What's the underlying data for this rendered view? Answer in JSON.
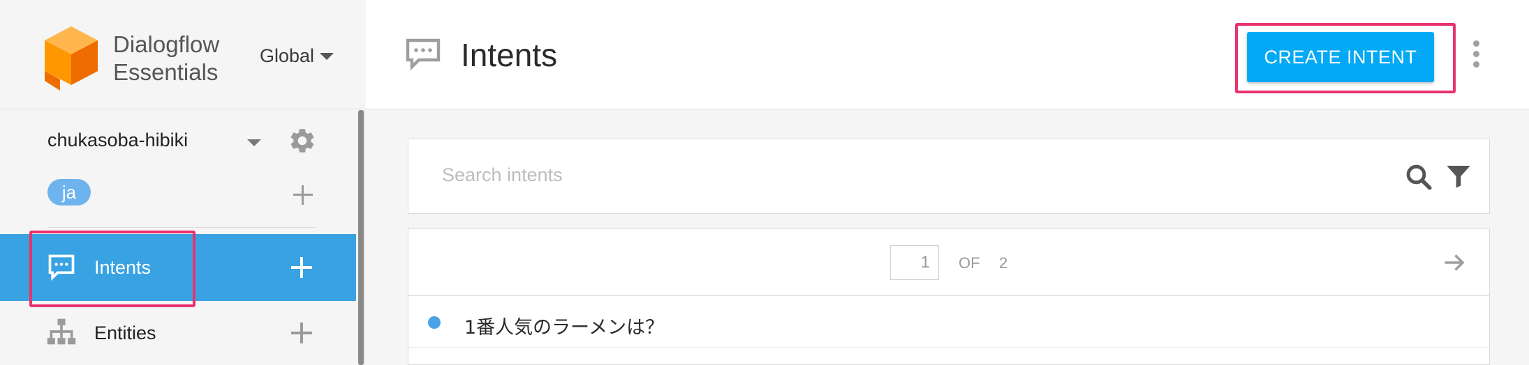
{
  "brand": {
    "name_line1": "Dialogflow",
    "name_line2": "Essentials",
    "region": "Global"
  },
  "agent": {
    "name": "chukasoba-hibiki",
    "language": "ja"
  },
  "nav": {
    "items": [
      {
        "label": "Intents",
        "icon": "chat-bubble-icon",
        "active": true
      },
      {
        "label": "Entities",
        "icon": "hierarchy-icon",
        "active": false
      }
    ]
  },
  "header": {
    "title": "Intents",
    "create_button": "CREATE INTENT"
  },
  "search": {
    "placeholder": "Search intents"
  },
  "pager": {
    "current_page": "1",
    "of_label": "OF",
    "total_pages": "2"
  },
  "intents": [
    {
      "name": "1番人気のラーメンは？"
    }
  ],
  "colors": {
    "accent": "#03a9f4",
    "active_nav": "#39a2e2",
    "highlight": "#e8336d",
    "language_badge": "#6db3ee"
  }
}
